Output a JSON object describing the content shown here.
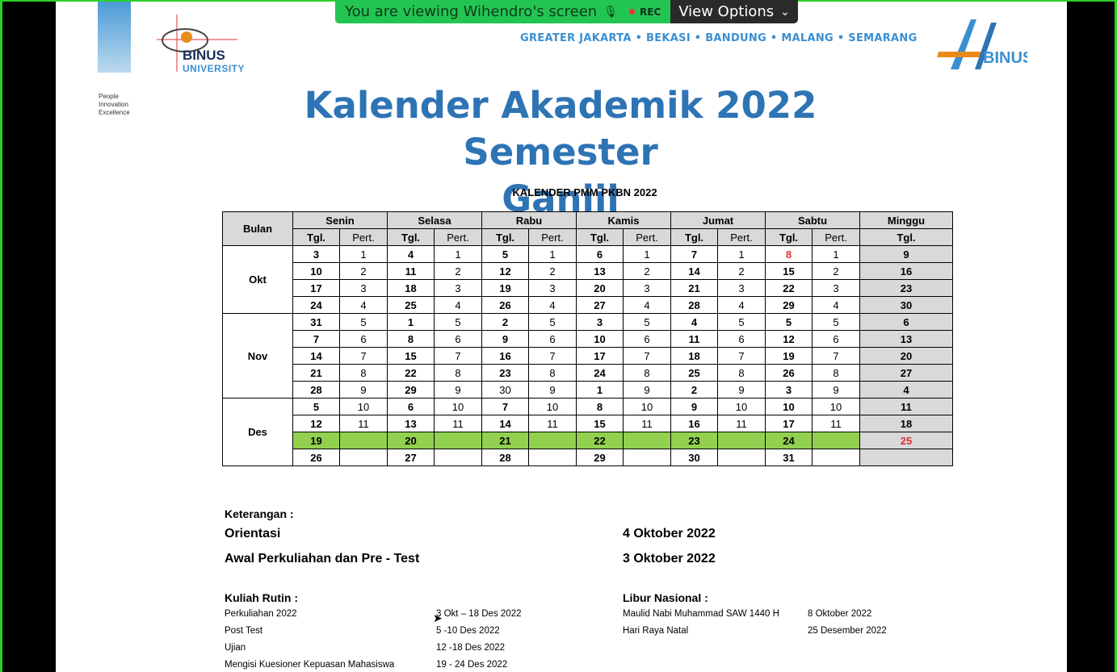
{
  "share_bar": {
    "viewing_text": "You are viewing Wihendro's screen",
    "rec_label": "REC",
    "view_options_label": "View Options"
  },
  "header": {
    "tagline": [
      "People",
      "Innovation",
      "Excellence"
    ],
    "logo_name": "BINUS",
    "logo_sub": "UNIVERSITY",
    "cities": "GREATER JAKARTA • BEKASI • BANDUNG • MALANG • SEMARANG",
    "anniv_brand": "BINUS"
  },
  "title_line1": "Kalender Akademik 2022 Semester",
  "title_line2": "Ganjil",
  "calendar": {
    "title": "KALENDER PMM PKBN 2022",
    "col_bulan": "Bulan",
    "days": [
      "Senin",
      "Selasa",
      "Rabu",
      "Kamis",
      "Jumat",
      "Sabtu",
      "Minggu"
    ],
    "sub_tgl": "Tgl.",
    "sub_pert": "Pert.",
    "months": [
      "Okt",
      "Nov",
      "Des"
    ],
    "rows": [
      [
        "3",
        "1",
        "4",
        "1",
        "5",
        "1",
        "6",
        "1",
        "7",
        "1",
        "8",
        "1",
        "9"
      ],
      [
        "10",
        "2",
        "11",
        "2",
        "12",
        "2",
        "13",
        "2",
        "14",
        "2",
        "15",
        "2",
        "16"
      ],
      [
        "17",
        "3",
        "18",
        "3",
        "19",
        "3",
        "20",
        "3",
        "21",
        "3",
        "22",
        "3",
        "23"
      ],
      [
        "24",
        "4",
        "25",
        "4",
        "26",
        "4",
        "27",
        "4",
        "28",
        "4",
        "29",
        "4",
        "30"
      ],
      [
        "31",
        "5",
        "1",
        "5",
        "2",
        "5",
        "3",
        "5",
        "4",
        "5",
        "5",
        "5",
        "6"
      ],
      [
        "7",
        "6",
        "8",
        "6",
        "9",
        "6",
        "10",
        "6",
        "11",
        "6",
        "12",
        "6",
        "13"
      ],
      [
        "14",
        "7",
        "15",
        "7",
        "16",
        "7",
        "17",
        "7",
        "18",
        "7",
        "19",
        "7",
        "20"
      ],
      [
        "21",
        "8",
        "22",
        "8",
        "23",
        "8",
        "24",
        "8",
        "25",
        "8",
        "26",
        "8",
        "27"
      ],
      [
        "28",
        "9",
        "29",
        "9",
        "30",
        "9",
        "1",
        "9",
        "2",
        "9",
        "3",
        "9",
        "4"
      ],
      [
        "5",
        "10",
        "6",
        "10",
        "7",
        "10",
        "8",
        "10",
        "9",
        "10",
        "10",
        "10",
        "11"
      ],
      [
        "12",
        "11",
        "13",
        "11",
        "14",
        "11",
        "15",
        "11",
        "16",
        "11",
        "17",
        "11",
        "18"
      ],
      [
        "19",
        "",
        "20",
        "",
        "21",
        "",
        "22",
        "",
        "23",
        "",
        "24",
        "",
        "25"
      ],
      [
        "26",
        "",
        "27",
        "",
        "28",
        "",
        "29",
        "",
        "30",
        "",
        "31",
        "",
        ""
      ]
    ]
  },
  "keterangan": {
    "heading": "Keterangan :",
    "orientasi_label": "Orientasi",
    "orientasi_date": "4 Oktober 2022",
    "awal_label": "Awal Perkuliahan dan Pre - Test",
    "awal_date": "3 Oktober 2022",
    "rutin_heading": "Kuliah Rutin :",
    "rutin": [
      {
        "label": "Perkuliahan 2022",
        "date": "3 Okt – 18 Des 2022"
      },
      {
        "label": "Post Test",
        "date": "5 -10 Des 2022"
      },
      {
        "label": "Ujian",
        "date": "12 -18 Des 2022"
      },
      {
        "label": "Mengisi Kuesioner Kepuasan Mahasiswa",
        "date": "19 - 24 Des 2022"
      }
    ],
    "libur_heading": "Libur Nasional :",
    "libur": [
      {
        "label": "Maulid Nabi Muhammad SAW 1440 H",
        "date": "8 Oktober 2022"
      },
      {
        "label": "Hari Raya Natal",
        "date": "25 Desember 2022"
      }
    ]
  },
  "colors": {
    "accent_blue": "#2e74b5",
    "holiday_red": "#e03030",
    "green_week": "#92d050",
    "screen_share_green": "#23c552"
  }
}
